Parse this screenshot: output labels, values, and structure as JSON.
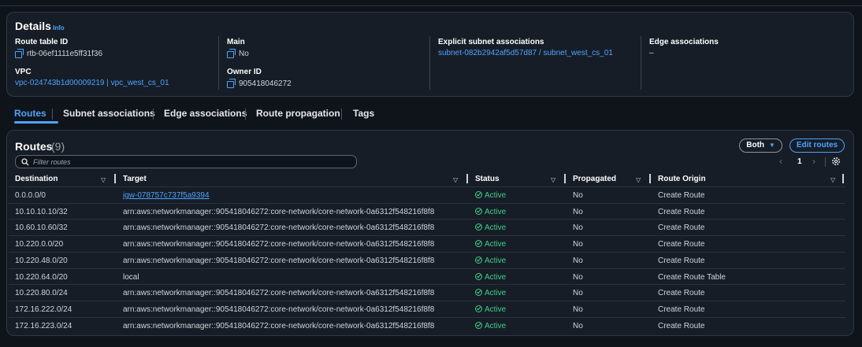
{
  "details": {
    "title": "Details",
    "info_link": "Info",
    "route_table_id": {
      "label": "Route table ID",
      "value": "rtb-06ef1111e5ff31f36"
    },
    "main": {
      "label": "Main",
      "value": "No"
    },
    "explicit_subnet": {
      "label": "Explicit subnet associations",
      "value": "subnet-082b2942af5d57d87 / subnet_west_cs_01"
    },
    "edge": {
      "label": "Edge associations",
      "value": "–"
    },
    "vpc": {
      "label": "VPC",
      "value": "vpc-024743b1d00009219 | vpc_west_cs_01"
    },
    "owner": {
      "label": "Owner ID",
      "value": "905418046272"
    }
  },
  "tabs": [
    {
      "label": "Routes",
      "active": true
    },
    {
      "label": "Subnet associations"
    },
    {
      "label": "Edge associations"
    },
    {
      "label": "Route propagation"
    },
    {
      "label": "Tags"
    }
  ],
  "routes": {
    "title": "Routes",
    "count": "(9)",
    "both_label": "Both",
    "edit_label": "Edit routes",
    "filter_placeholder": "Filter routes",
    "page": "1",
    "columns": [
      "Destination",
      "Target",
      "Status",
      "Propagated",
      "Route Origin"
    ],
    "rows": [
      {
        "destination": "0.0.0.0/0",
        "target": "igw-078757c737f5a9394",
        "target_link": true,
        "status": "Active",
        "propagated": "No",
        "origin": "Create Route"
      },
      {
        "destination": "10.10.10.10/32",
        "target": "arn:aws:networkmanager::905418046272:core-network/core-network-0a6312f548216f8f8",
        "status": "Active",
        "propagated": "No",
        "origin": "Create Route"
      },
      {
        "destination": "10.60.10.60/32",
        "target": "arn:aws:networkmanager::905418046272:core-network/core-network-0a6312f548216f8f8",
        "status": "Active",
        "propagated": "No",
        "origin": "Create Route"
      },
      {
        "destination": "10.220.0.0/20",
        "target": "arn:aws:networkmanager::905418046272:core-network/core-network-0a6312f548216f8f8",
        "status": "Active",
        "propagated": "No",
        "origin": "Create Route"
      },
      {
        "destination": "10.220.48.0/20",
        "target": "arn:aws:networkmanager::905418046272:core-network/core-network-0a6312f548216f8f8",
        "status": "Active",
        "propagated": "No",
        "origin": "Create Route"
      },
      {
        "destination": "10.220.64.0/20",
        "target": "local",
        "status": "Active",
        "propagated": "No",
        "origin": "Create Route Table"
      },
      {
        "destination": "10.220.80.0/24",
        "target": "arn:aws:networkmanager::905418046272:core-network/core-network-0a6312f548216f8f8",
        "status": "Active",
        "propagated": "No",
        "origin": "Create Route"
      },
      {
        "destination": "172.16.222.0/24",
        "target": "arn:aws:networkmanager::905418046272:core-network/core-network-0a6312f548216f8f8",
        "status": "Active",
        "propagated": "No",
        "origin": "Create Route"
      },
      {
        "destination": "172.16.223.0/24",
        "target": "arn:aws:networkmanager::905418046272:core-network/core-network-0a6312f548216f8f8",
        "status": "Active",
        "propagated": "No",
        "origin": "Create Route"
      }
    ]
  },
  "colors": {
    "accent": "#4ea3ff",
    "active_status": "#3fcf8e",
    "background": "#0f141a",
    "panel": "#161d26"
  }
}
